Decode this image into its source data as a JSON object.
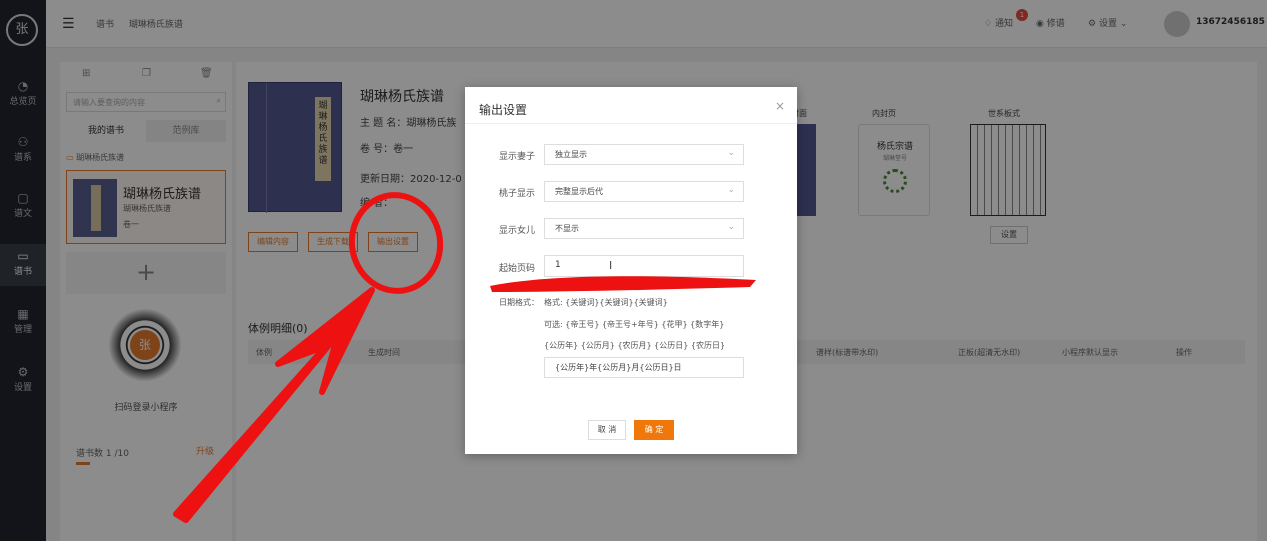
{
  "nav": {
    "logo": "张",
    "items": [
      {
        "label": "总览页",
        "icon": "◔"
      },
      {
        "label": "谱系",
        "icon": "⚇"
      },
      {
        "label": "谱文",
        "icon": "▢"
      },
      {
        "label": "谱书",
        "icon": "▭"
      },
      {
        "label": "管理",
        "icon": "▦"
      },
      {
        "label": "设置",
        "icon": "⚙"
      }
    ]
  },
  "topbar": {
    "menu_icon": "☰",
    "breadcrumb": [
      "谱书",
      "瑚琳杨氏族谱"
    ],
    "notify_label": "通知",
    "notify_count": "1",
    "edit_label": "修谱",
    "settings_label": "设置",
    "phone": "13672456185"
  },
  "panel": {
    "search_placeholder": "请输入要查询的内容",
    "tab_my": "我的谱书",
    "tab_examples": "范例库",
    "folder": "瑚琳杨氏族谱",
    "book_title": "瑚琳杨氏族谱",
    "book_sub": "瑚琳杨氏族谱",
    "book_vol": "卷一",
    "qr_label": "扫码登录小程序",
    "count_label": "谱书数 1 /10",
    "upgrade": "升级"
  },
  "main": {
    "cover_label": "瑚琳杨氏族谱",
    "title": "瑚琳杨氏族谱",
    "field_theme": "主 题 名：瑚琳杨氏族",
    "field_vol": "卷       号：卷一",
    "field_date": "更新日期：2020-12-0",
    "field_editor": "编       者：",
    "btn_edit": "编辑内容",
    "btn_generate": "生成下载",
    "btn_output": "输出设置",
    "card_cover": "封面",
    "card_inner": "内封页",
    "card_tree": "世系板式",
    "inner_t1": "杨氏宗谱",
    "inner_t2": "瑚琳堂号",
    "tree_btn": "设置",
    "section_title": "体例明细(0)",
    "table_headers": [
      "体例",
      "生成时间",
      "谱样(标谱带水印)",
      "正板(超清无水印)",
      "小程序默认显示",
      "操作"
    ]
  },
  "dialog": {
    "title": "输出设置",
    "close": "×",
    "rows": [
      {
        "label": "显示妻子",
        "value": "独立显示"
      },
      {
        "label": "桃子显示",
        "value": "完整显示后代"
      },
      {
        "label": "显示女儿",
        "value": "不显示"
      }
    ],
    "start_page_label": "起始页码",
    "start_page_value": "1",
    "date_label": "日期格式：",
    "date_hint1": "格式: {关键词}{关键词}{关键词}",
    "date_hint2": "可选: {帝王号} {帝王号+年号} {花甲} {数字年}",
    "date_hint3": "{公历年} {公历月} {农历月} {公历日} {农历日}",
    "date_value": "{公历年}年{公历月}月{公历日}日",
    "cancel": "取 消",
    "ok": "确 定"
  },
  "colors": {
    "accent": "#f0780a",
    "annotation": "#ee1111",
    "nav_bg": "#23262e"
  }
}
